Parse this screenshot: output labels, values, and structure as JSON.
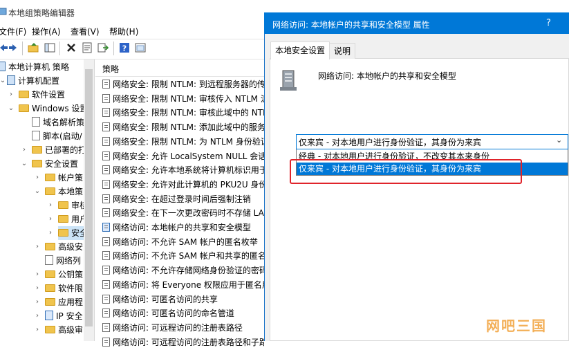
{
  "app": {
    "title": "本地组策略编辑器"
  },
  "menu": [
    "文件(F)",
    "操作(A)",
    "查看(V)",
    "帮助(H)"
  ],
  "toolbar": {
    "icons": [
      "back-arrow",
      "forward-arrow",
      "up-folder",
      "show-hide-tree",
      "delete",
      "properties",
      "export-list",
      "help",
      "show-console"
    ]
  },
  "tree": [
    {
      "label": "本地计算机 策略",
      "icon": "computer"
    },
    {
      "label": "计算机配置",
      "icon": "computer"
    },
    {
      "label": "软件设置",
      "icon": "folder"
    },
    {
      "label": "Windows 设置",
      "icon": "folder"
    },
    {
      "label": "域名解析策",
      "icon": "doc"
    },
    {
      "label": "脚本(启动/",
      "icon": "doc"
    },
    {
      "label": "已部署的打",
      "icon": "folder"
    },
    {
      "label": "安全设置",
      "icon": "folder"
    },
    {
      "label": "帐户策",
      "icon": "folder"
    },
    {
      "label": "本地策",
      "icon": "folder"
    },
    {
      "label": "审核",
      "icon": "folder"
    },
    {
      "label": "用户",
      "icon": "folder"
    },
    {
      "label": "安全",
      "icon": "folder"
    },
    {
      "label": "高级安",
      "icon": "folder"
    },
    {
      "label": "网络列",
      "icon": "doc"
    },
    {
      "label": "公钥策",
      "icon": "folder"
    },
    {
      "label": "软件限",
      "icon": "folder"
    },
    {
      "label": "应用程",
      "icon": "folder"
    },
    {
      "label": "IP 安全",
      "icon": "folder"
    },
    {
      "label": "高级审",
      "icon": "folder"
    }
  ],
  "list": {
    "column": "策略",
    "rows": [
      "网络安全: 限制 NTLM: 到远程服务器的传",
      "网络安全: 限制 NTLM: 审核传入 NTLM 流",
      "网络安全: 限制 NTLM: 审核此域中的 NTL",
      "网络安全: 限制 NTLM: 添加此域中的服务",
      "网络安全: 限制 NTLM: 为 NTLM 身份验证",
      "网络安全: 允许 LocalSystem NULL 会话回",
      "网络安全: 允许本地系统将计算机标识用于",
      "网络安全: 允许对此计算机的 PKU2U 身份",
      "网络安全: 在超过登录时间后强制注销",
      "网络安全: 在下一次更改密码时不存储 LAN",
      "网络访问: 本地帐户的共享和安全模型",
      "网络访问: 不允许 SAM 帐户的匿名枚举",
      "网络访问: 不允许 SAM 帐户和共享的匿名",
      "网络访问: 不允许存储网络身份验证的密码",
      "网络访问: 将 Everyone 权限应用于匿名用",
      "网络访问: 可匿名访问的共享",
      "网络访问: 可匿名访问的命名管道",
      "网络访问: 可远程访问的注册表路径",
      "网络访问: 可远程访问的注册表路径和子路"
    ]
  },
  "dialog": {
    "title": "网络访问: 本地帐户的共享和安全模型 属性",
    "help": "?",
    "tabs": [
      "本地安全设置",
      "说明"
    ],
    "policy_name": "网络访问: 本地帐户的共享和安全模型",
    "combo_value": "仅来宾 - 对本地用户进行身份验证，其身份为来宾",
    "options": [
      "经典 - 对本地用户进行身份验证，不改变其本来身份",
      "仅来宾 - 对本地用户进行身份验证，其身份为来宾"
    ],
    "selected_index": 1
  },
  "watermark": "网吧三国",
  "colors": {
    "accent": "#0078d7",
    "highlight_box": "#e0242b",
    "folder": "#f0c44d"
  }
}
